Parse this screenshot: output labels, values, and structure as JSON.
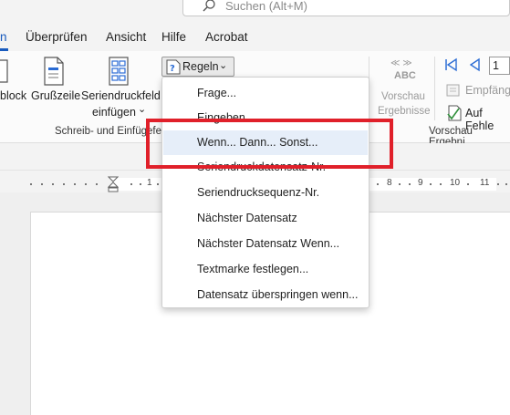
{
  "search": {
    "placeholder": "Suchen (Alt+M)"
  },
  "tabs": [
    {
      "label": "n",
      "active": true
    },
    {
      "label": "Überprüfen"
    },
    {
      "label": "Ansicht"
    },
    {
      "label": "Hilfe"
    },
    {
      "label": "Acrobat"
    }
  ],
  "ribbon": {
    "block_label": "block",
    "grusszeile_label": "Grußzeile",
    "seriendruckfeld_line1": "Seriendruckfeld",
    "seriendruckfeld_line2": "einfügen",
    "seriendruckfeld_caret": "⌄",
    "regeln_label": "Regeln",
    "regeln_caret": "⌄",
    "vorschau_line1": "Vorschau",
    "vorschau_line2": "Ergebnisse",
    "abc_top": "≪ ≫",
    "abc_label": "ABC",
    "record_number": "1",
    "empfaenger_label": "Empfäng",
    "auf_fehler_label": "Auf Fehle",
    "group_schreib": "Schreib- und Einfügefe",
    "group_vorschau": "Vorschau Ergebni"
  },
  "ruler": {
    "numbers": [
      "1",
      "8",
      "9",
      "10",
      "11"
    ]
  },
  "dropdown": {
    "items": [
      {
        "label": "Frage..."
      },
      {
        "label": "Eingeben"
      },
      {
        "label": "Wenn... Dann... Sonst..."
      },
      {
        "label": "Seriendruckdatensatz-Nr."
      },
      {
        "label": "Seriendrucksequenz-Nr."
      },
      {
        "label": "Nächster Datensatz"
      },
      {
        "label": "Nächster Datensatz Wenn..."
      },
      {
        "label": "Textmarke festlegen..."
      },
      {
        "label": "Datensatz überspringen wenn..."
      }
    ]
  },
  "colors": {
    "accent": "#185abd",
    "highlight_box": "#e0202a",
    "hover_bg": "#e6eef9"
  },
  "icons": [
    "search-icon",
    "address-block-icon",
    "greeting-line-icon",
    "insert-merge-field-icon",
    "rules-icon",
    "preview-results-icon",
    "first-record-icon",
    "previous-record-icon",
    "find-recipient-icon",
    "check-errors-icon"
  ]
}
